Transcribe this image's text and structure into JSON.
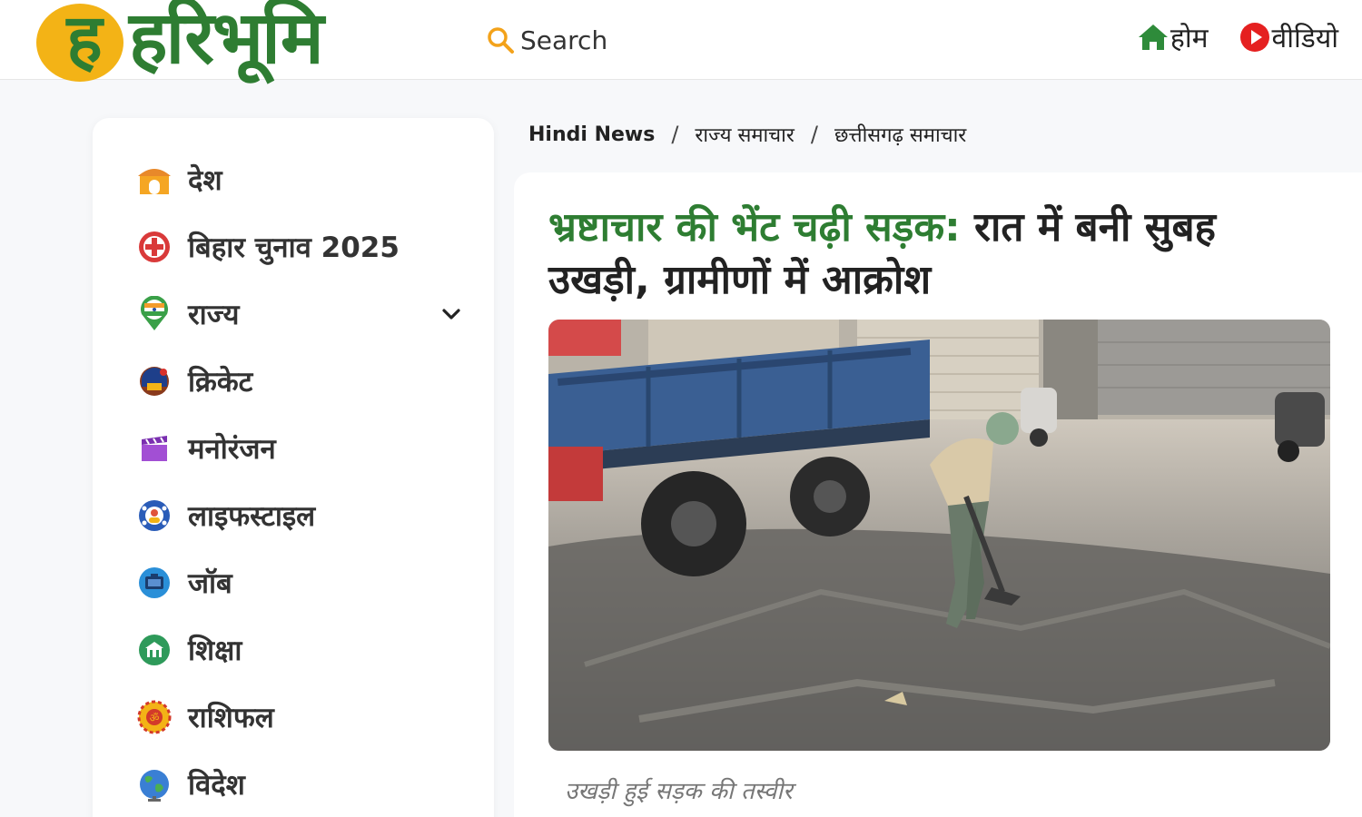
{
  "header": {
    "logo_text": "हरिभूमि",
    "logo_letter": "ह",
    "search_label": "Search",
    "nav": [
      {
        "label": "होम",
        "icon": "home-icon"
      },
      {
        "label": "वीडियो",
        "icon": "video-play-icon"
      }
    ],
    "colors": {
      "brand_green": "#2e7d32",
      "brand_yellow": "#f3b316",
      "video_red": "#e52020"
    }
  },
  "sidebar": {
    "items": [
      {
        "label": "देश",
        "icon": "temple-gate-icon"
      },
      {
        "label": "बिहार चुनाव 2025",
        "icon": "election-cross-icon"
      },
      {
        "label": "राज्य",
        "icon": "india-map-pin-icon",
        "has_submenu": true
      },
      {
        "label": "क्रिकेट",
        "icon": "cricket-helmet-icon"
      },
      {
        "label": "मनोरंजन",
        "icon": "clapperboard-icon"
      },
      {
        "label": "लाइफस्टाइल",
        "icon": "lifestyle-globe-icon"
      },
      {
        "label": "जॉब",
        "icon": "job-briefcase-icon"
      },
      {
        "label": "शिक्षा",
        "icon": "education-building-icon"
      },
      {
        "label": "राशिफल",
        "icon": "om-zodiac-icon"
      },
      {
        "label": "विदेश",
        "icon": "world-globe-icon"
      }
    ]
  },
  "breadcrumb": [
    "Hindi News",
    "राज्य समाचार",
    "छत्तीसगढ़ समाचार"
  ],
  "article": {
    "headline_accent": "भ्रष्टाचार की भेंट चढ़ी सड़क:",
    "headline_rest": " रात में बनी सुबह उखड़ी, ग्रामीणों में आक्रोश",
    "image": "photo of worker shoveling broken asphalt road beside a blue tractor trolley",
    "caption": "उखड़ी हुई सड़क की तस्वीर"
  }
}
